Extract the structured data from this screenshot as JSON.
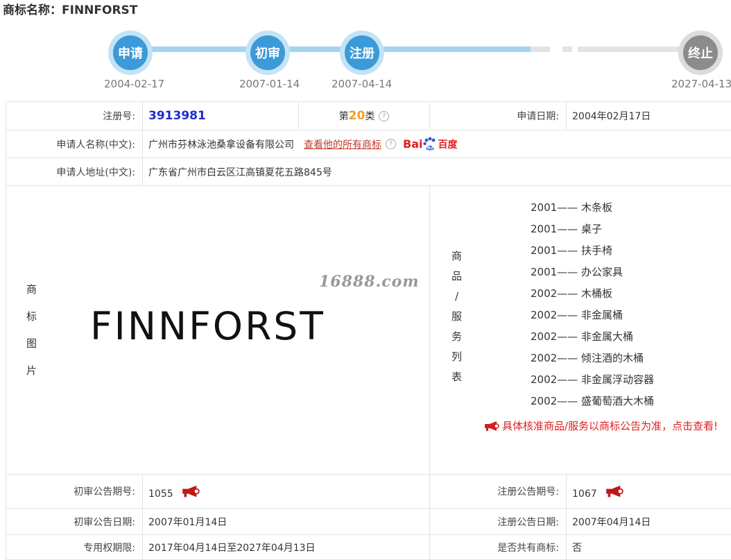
{
  "title": {
    "label": "商标名称：",
    "name": "FINNFORST"
  },
  "timeline": [
    {
      "label": "申请",
      "date": "2004-02-17"
    },
    {
      "label": "初审",
      "date": "2007-01-14"
    },
    {
      "label": "注册",
      "date": "2007-04-14"
    },
    {
      "label": "终止",
      "date": "2027-04-13"
    }
  ],
  "row1": {
    "reg_label": "注册号:",
    "reg_no": "3913981",
    "class_prefix": "第",
    "class_num": "20",
    "class_suffix": "类",
    "help_glyph": "?",
    "apply_date_label": "申请日期:",
    "apply_date": "2004年02月17日"
  },
  "row2": {
    "label": "申请人名称(中文):",
    "value": "广州市芬林泳池桑拿设备有限公司",
    "link": "查看他的所有商标",
    "help_glyph": "?",
    "baidu_a": "Bai",
    "baidu_b": "百度"
  },
  "row3": {
    "label": "申请人地址(中文):",
    "value": "广东省广州市白云区江高镇夏花五路845号"
  },
  "image_label": [
    "商",
    "标",
    "图",
    "片"
  ],
  "image_text": "FINNFORST",
  "watermark": "16888.com",
  "goods_label": [
    "商",
    "品",
    "/",
    "服",
    "务",
    "列",
    "表"
  ],
  "goods": [
    "2001—— 木条板",
    "2001—— 桌子",
    "2001—— 扶手椅",
    "2001—— 办公家具",
    "2002—— 木桶板",
    "2002—— 非金属桶",
    "2002—— 非金属大桶",
    "2002—— 倾注酒的木桶",
    "2002—— 非金属浮动容器",
    "2002—— 盛葡萄酒大木桶"
  ],
  "notice": "具体核准商品/服务以商标公告为准，点击查看!",
  "pub": {
    "prelim_no_label": "初审公告期号:",
    "prelim_no": "1055",
    "reg_no_label": "注册公告期号:",
    "reg_no": "1067",
    "prelim_date_label": "初审公告日期:",
    "prelim_date": "2007年01月14日",
    "reg_date_label": "注册公告日期:",
    "reg_date": "2007年04月14日",
    "term_label": "专用权期限:",
    "term": "2017年04月14日至2027年04月13日",
    "shared_label": "是否共有商标:",
    "shared": "否"
  },
  "colors": {
    "timeline_blue": "#3d9ad8",
    "timeline_gray": "#8c8c8c",
    "link_red": "#c0392b",
    "reg_blue": "#1d2dc8",
    "class_orange": "#f0a020"
  }
}
